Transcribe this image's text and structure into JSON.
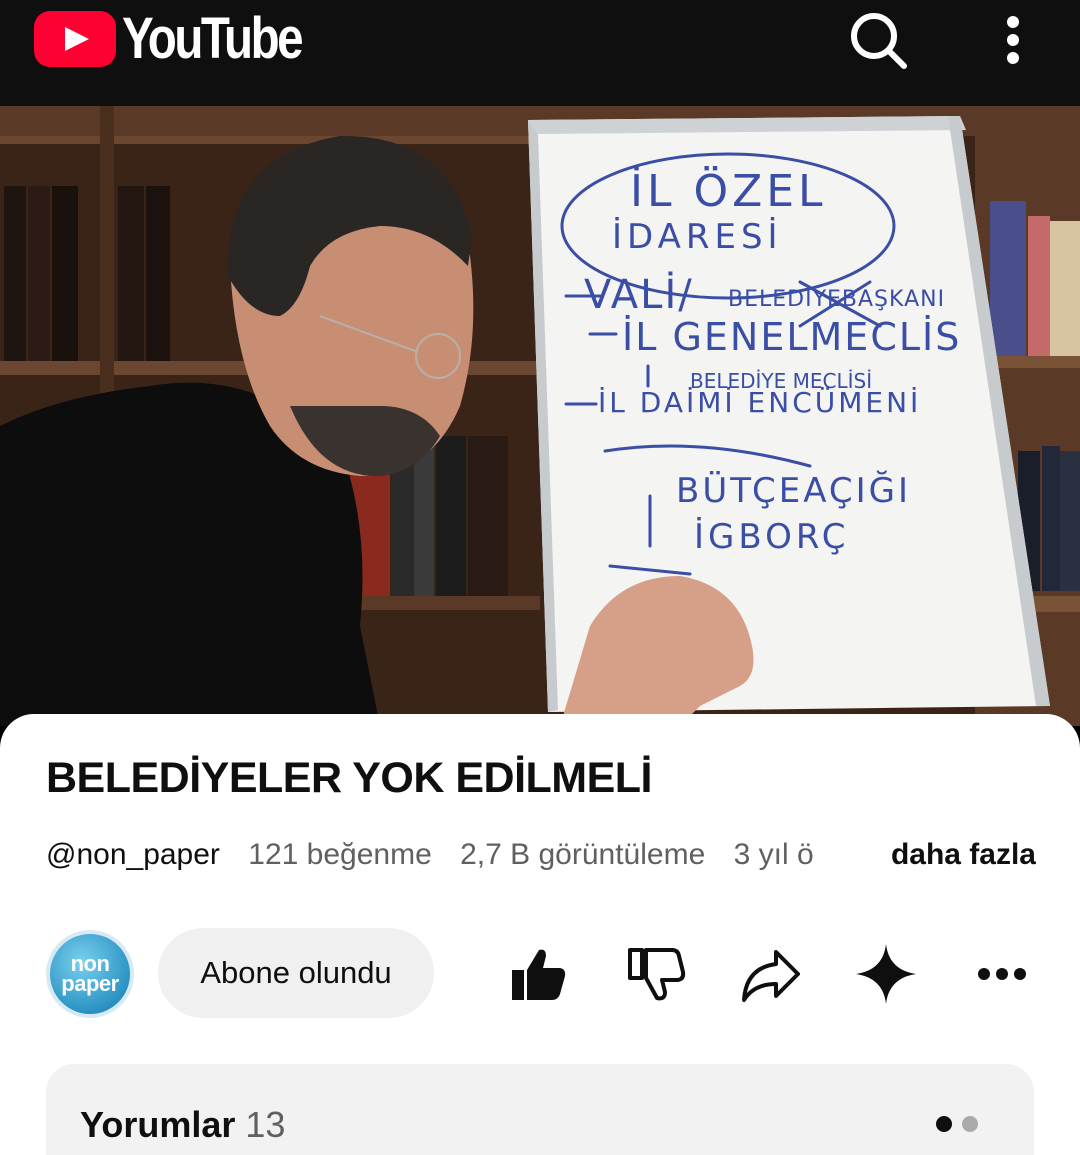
{
  "header": {
    "logo_text": "YouTube",
    "icons": [
      "search-icon",
      "more-vert-icon"
    ]
  },
  "video": {
    "whiteboard_text": [
      "İL ÖZEL",
      "İDARESİ",
      "-VALİ/BELEDİYE BAŞKANI",
      "-İL GENEL MECLİS",
      "BELEDİYE MECLİSİ",
      "-İL DAİMİ ENCÜMENİ",
      "BÜTÇE AÇIĞI",
      "İGBORÇ"
    ]
  },
  "info": {
    "title": "BELEDİYELER YOK EDİLMELİ",
    "channel_handle": "@non_paper",
    "likes": "121 beğenme",
    "views": "2,7 B görüntüleme",
    "age": "3 yıl ö",
    "more": "daha fazla"
  },
  "actions": {
    "avatar_line1": "non",
    "avatar_line2": "paper",
    "subscribe_label": "Abone olundu",
    "icons": [
      "thumbs-up-icon",
      "thumbs-down-icon",
      "share-icon",
      "sparkle-icon",
      "more-horiz-icon"
    ]
  },
  "comments": {
    "label": "Yorumlar",
    "count": "13"
  },
  "colors": {
    "brand_red": "#ff0033",
    "topbar": "#0f0f0f",
    "secondary_text": "#606060",
    "chip_bg": "#f0f0f0"
  }
}
